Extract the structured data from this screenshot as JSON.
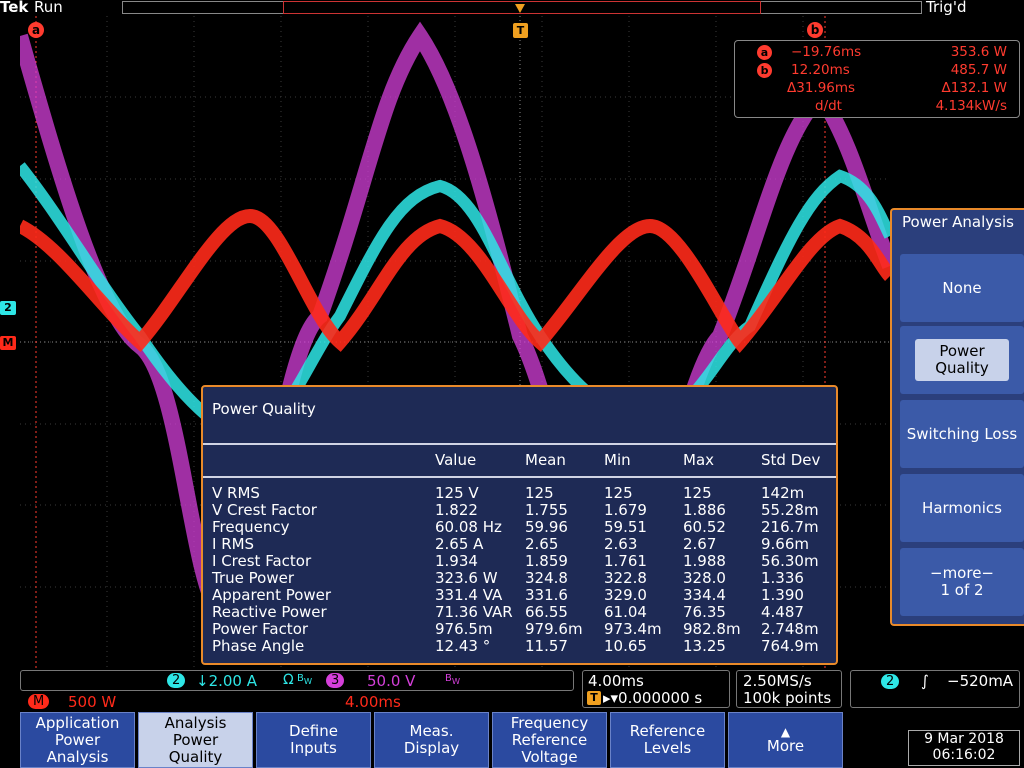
{
  "topbar": {
    "brand": "Tek",
    "run_state": "Run",
    "trigger_state": "Trig'd"
  },
  "markers": {
    "cursor_a": "a",
    "cursor_b": "b",
    "trigger": "T",
    "ch2": "2",
    "math": "M"
  },
  "cursor_readout": {
    "rows": [
      {
        "badge": "a",
        "time": "−19.76ms",
        "value": "353.6 W"
      },
      {
        "badge": "b",
        "time": "12.20ms",
        "value": "485.7 W"
      },
      {
        "badge": "",
        "time": "Δ31.96ms",
        "value": "Δ132.1 W"
      },
      {
        "badge": "",
        "time": "d/dt",
        "value": "4.134kW/s"
      }
    ]
  },
  "power_quality": {
    "title": "Power Quality",
    "columns": [
      "",
      "Value",
      "Mean",
      "Min",
      "Max",
      "Std Dev"
    ],
    "rows": [
      [
        "V RMS",
        "125 V",
        "125",
        "125",
        "125",
        "142m"
      ],
      [
        "V Crest Factor",
        "1.822",
        "1.755",
        "1.679",
        "1.886",
        "55.28m"
      ],
      [
        "Frequency",
        "60.08 Hz",
        "59.96",
        "59.51",
        "60.52",
        "216.7m"
      ],
      [
        "I RMS",
        "2.65 A",
        "2.65",
        "2.63",
        "2.67",
        "9.66m"
      ],
      [
        "I Crest Factor",
        "1.934",
        "1.859",
        "1.761",
        "1.988",
        "56.30m"
      ],
      [
        "True Power",
        "323.6 W",
        "324.8",
        "322.8",
        "328.0",
        "1.336"
      ],
      [
        "Apparent Power",
        "331.4 VA",
        "331.6",
        "329.0",
        "334.4",
        "1.390"
      ],
      [
        "Reactive Power",
        "71.36 VAR",
        "66.55",
        "61.04",
        "76.35",
        "4.487"
      ],
      [
        "Power Factor",
        "976.5m",
        "979.6m",
        "973.4m",
        "982.8m",
        "2.748m"
      ],
      [
        "Phase Angle",
        "12.43 °",
        "11.57",
        "10.65",
        "13.25",
        "764.9m"
      ]
    ]
  },
  "side_menu": {
    "title": "Power Analysis",
    "items": [
      {
        "label": "None"
      },
      {
        "label": "Power Quality",
        "selected": true
      },
      {
        "label": "Switching Loss"
      },
      {
        "label": "Harmonics"
      },
      {
        "label": "−more−",
        "sub": "1 of 2"
      }
    ]
  },
  "status": {
    "ch2_badge": "2",
    "ch2_scale": "↓2.00 A",
    "ch2_coupling": "Ω",
    "ch2_bw": "B",
    "ch2_bw_sub": "W",
    "ch3_badge": "3",
    "ch3_scale": "50.0 V",
    "ch3_bw": "B",
    "ch3_bw_sub": "W",
    "math_badge": "M",
    "math_scale": "500 W",
    "math_time": "4.00ms",
    "timebase": "4.00ms",
    "trigger_pos_label": "T",
    "trigger_pos": "▸▾0.000000 s",
    "sample_rate": "2.50MS/s",
    "record_length": "100k points",
    "trig_channel": "2",
    "trig_slope": "∫",
    "trig_level": "−520mA"
  },
  "bottom_buttons": [
    {
      "lines": [
        "Application",
        "Power",
        "Analysis"
      ]
    },
    {
      "lines": [
        "Analysis",
        "Power",
        "Quality"
      ],
      "selected": true
    },
    {
      "lines": [
        "Define",
        "Inputs"
      ]
    },
    {
      "lines": [
        "Meas.",
        "Display"
      ]
    },
    {
      "lines": [
        "Frequency",
        "Reference",
        "Voltage"
      ]
    },
    {
      "lines": [
        "Reference",
        "Levels"
      ]
    },
    {
      "lines": [
        "More"
      ]
    }
  ],
  "datetime": {
    "date": "9 Mar 2018",
    "time": "06:16:02"
  },
  "colors": {
    "ch2": "#2ee6e6",
    "ch3": "#d43fd9",
    "math": "#ff2a1a",
    "accent": "#e98a2a",
    "menu": "#2b4aa0"
  }
}
